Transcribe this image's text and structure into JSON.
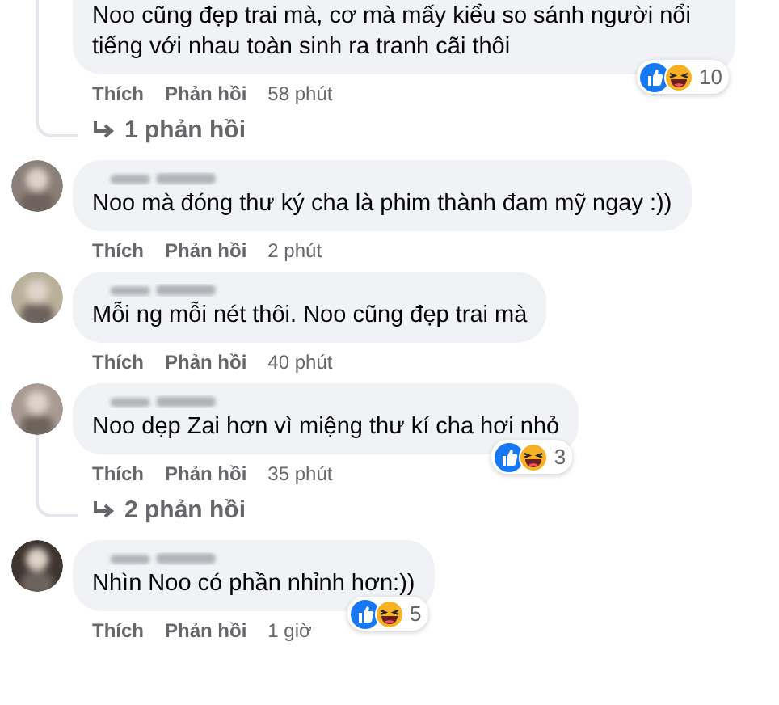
{
  "comments": [
    {
      "avatar": false,
      "author_blurred": false,
      "text": "Noo cũng đẹp trai mà, cơ mà mấy kiểu so sánh người nổi tiếng với nhau toàn sinh ra tranh cãi thôi",
      "reactions": {
        "count": "10"
      },
      "actions": [
        "Thích",
        "Phản hồi"
      ],
      "time": "58 phút",
      "replies_link": "1 phản hồi"
    },
    {
      "avatar": true,
      "author_blurred": true,
      "text": "Noo mà đóng thư ký cha là phim thành đam mỹ ngay :))",
      "actions": [
        "Thích",
        "Phản hồi"
      ],
      "time": "2 phút"
    },
    {
      "avatar": true,
      "author_blurred": true,
      "text": "Mỗi ng mỗi nét thôi. Noo cũng đẹp trai mà",
      "actions": [
        "Thích",
        "Phản hồi"
      ],
      "time": "40 phút"
    },
    {
      "avatar": true,
      "author_blurred": true,
      "text": "Noo dẹp Zai hơn vì miệng thư kí cha hơi nhỏ",
      "reactions": {
        "count": "3"
      },
      "actions": [
        "Thích",
        "Phản hồi"
      ],
      "time": "35 phút",
      "replies_link": "2 phản hồi"
    },
    {
      "avatar": true,
      "author_blurred": true,
      "text": "Nhìn Noo có phần nhỉnh hơn:))",
      "reactions": {
        "count": "5"
      },
      "actions": [
        "Thích",
        "Phản hồi"
      ],
      "time": "1 giờ"
    }
  ]
}
